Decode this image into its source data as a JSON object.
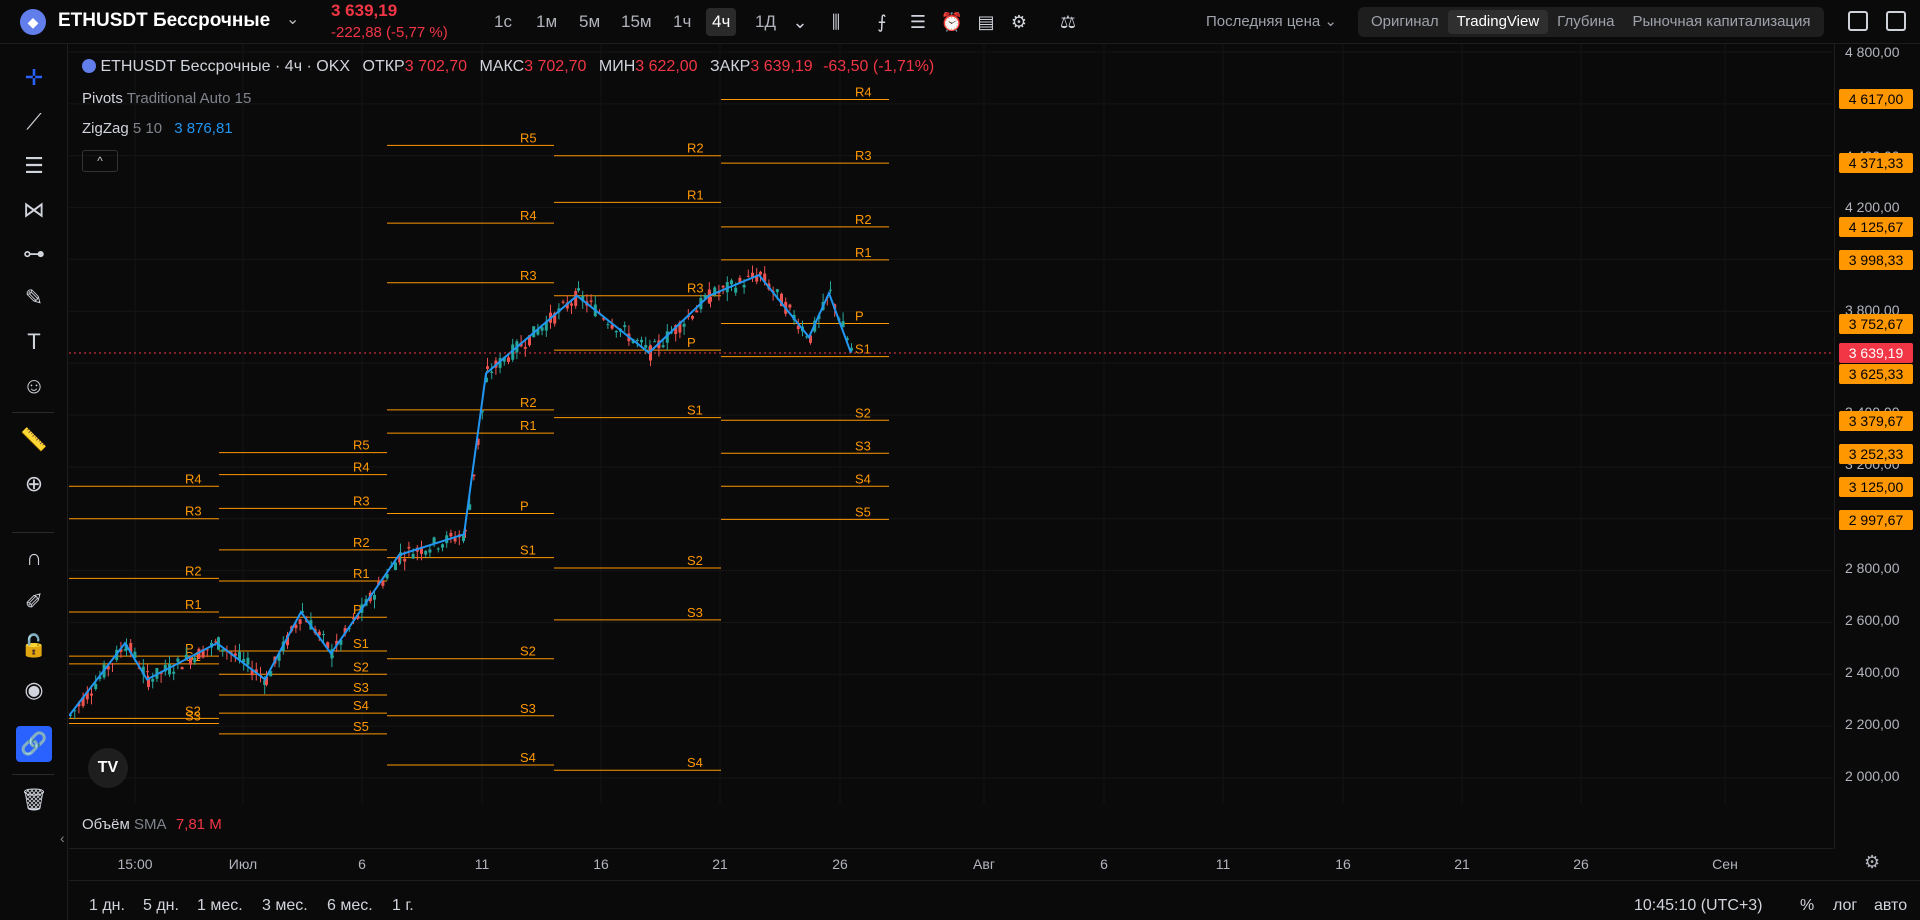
{
  "header": {
    "symbol": "ETHUSDT Бессрочные",
    "last_price": "3 639,19",
    "change": "-222,88 (-5,77 %)",
    "timeframes": [
      "1с",
      "1м",
      "5м",
      "15м",
      "1ч",
      "4ч",
      "1Д"
    ],
    "active_timeframe": "4ч",
    "price_type": "Последняя цена",
    "view_tabs": [
      "Оригинал",
      "TradingView",
      "Глубина",
      "Рыночная капитализация"
    ],
    "active_view": "TradingView"
  },
  "legend": {
    "title": "ETHUSDT Бессрочные · 4ч · OKX",
    "open_label": "ОТКР",
    "open": "3 702,70",
    "high_label": "МАКС",
    "high": "3 702,70",
    "low_label": "МИН",
    "low": "3 622,00",
    "close_label": "ЗАКР",
    "close": "3 639,19",
    "change": "-63,50 (-1,71%)",
    "pivots_name": "Pivots",
    "pivots_params": "Traditional Auto 15",
    "zigzag_name": "ZigZag",
    "zigzag_params": "5 10",
    "zigzag_value": "3 876,81",
    "volume_name": "Объём",
    "volume_sma": "SMA",
    "volume_value": "7,81 M"
  },
  "price_axis": {
    "ticks": [
      "4 800,00",
      "4 400,00",
      "4 200,00",
      "3 800,00",
      "3 400,00",
      "3 200,00",
      "2 800,00",
      "2 600,00",
      "2 400,00",
      "2 200,00",
      "2 000,00"
    ],
    "labels": [
      "4 617,00",
      "4 371,33",
      "4 125,67",
      "3 998,33",
      "3 752,67",
      "3 639,19",
      "3 625,33",
      "3 379,67",
      "3 252,33",
      "3 125,00",
      "2 997,67"
    ]
  },
  "time_axis": {
    "ticks": [
      "15:00",
      "Июл",
      "6",
      "11",
      "16",
      "21",
      "26",
      "Авг",
      "6",
      "11",
      "16",
      "21",
      "26",
      "Сен"
    ]
  },
  "bottom": {
    "ranges": [
      "1 дн.",
      "5 дн.",
      "1 мес.",
      "3 мес.",
      "6 мес.",
      "1 г."
    ],
    "clock": "10:45:10 (UTC+3)",
    "percent": "%",
    "log": "лог",
    "auto": "авто"
  },
  "pivots": {
    "labels": [
      "R5",
      "R4",
      "R3",
      "R2",
      "R1",
      "P",
      "S1",
      "S2",
      "S3",
      "S4",
      "S5"
    ]
  },
  "colors": {
    "up": "#26a69a",
    "down": "#ef5350",
    "pivot": "#ff9800",
    "zigzag": "#2196f3",
    "accent": "#2962ff"
  },
  "chart_data": {
    "type": "candlestick",
    "symbol": "ETHUSDT",
    "interval": "4h",
    "ylim": [
      1900,
      4800
    ],
    "zigzag": [
      [
        0,
        2240
      ],
      [
        1,
        2520
      ],
      [
        2,
        2380
      ],
      [
        3,
        2520
      ],
      [
        4,
        2380
      ],
      [
        5,
        2640
      ],
      [
        6,
        2480
      ],
      [
        7,
        2860
      ],
      [
        8,
        2940
      ],
      [
        9,
        3560
      ],
      [
        10,
        3860
      ],
      [
        11,
        3640
      ],
      [
        12,
        3860
      ],
      [
        13,
        3940
      ],
      [
        14,
        3700
      ],
      [
        15,
        3870
      ],
      [
        16,
        3639
      ]
    ],
    "pivot_periods": [
      {
        "R5": null,
        "R4": 3125,
        "R3": 3000,
        "R2": 2770,
        "R1": 2640,
        "P": 2470,
        "S1": 2440,
        "S2": 2230,
        "S3": 2210
      },
      {
        "R5": 3255,
        "R4": 3170,
        "R3": 3040,
        "R2": 2880,
        "R1": 2760,
        "P": 2620,
        "S1": 2490,
        "S2": 2400,
        "S3": 2320,
        "S4": 2250,
        "S5": 2170
      },
      {
        "R5": 4440,
        "R4": 4140,
        "R3": 3910,
        "R2": 3420,
        "R1": 3330,
        "P": 3020,
        "S1": 2850,
        "S2": 2460,
        "S3": 2240,
        "S4": 2050
      },
      {
        "R2": 4400,
        "R1": 4220,
        "R3": 3860,
        "P": 3650,
        "S1": 3390,
        "S2": 2810,
        "S3": 2610,
        "S4": 2030
      },
      {
        "R4": 4617,
        "R3": 4371.33,
        "R2": 4125.67,
        "R1": 3998.33,
        "P": 3752.67,
        "S1": 3625.33,
        "S2": 3379.67,
        "S3": 3252.33,
        "S4": 3125,
        "S5": 2997.67
      }
    ]
  }
}
